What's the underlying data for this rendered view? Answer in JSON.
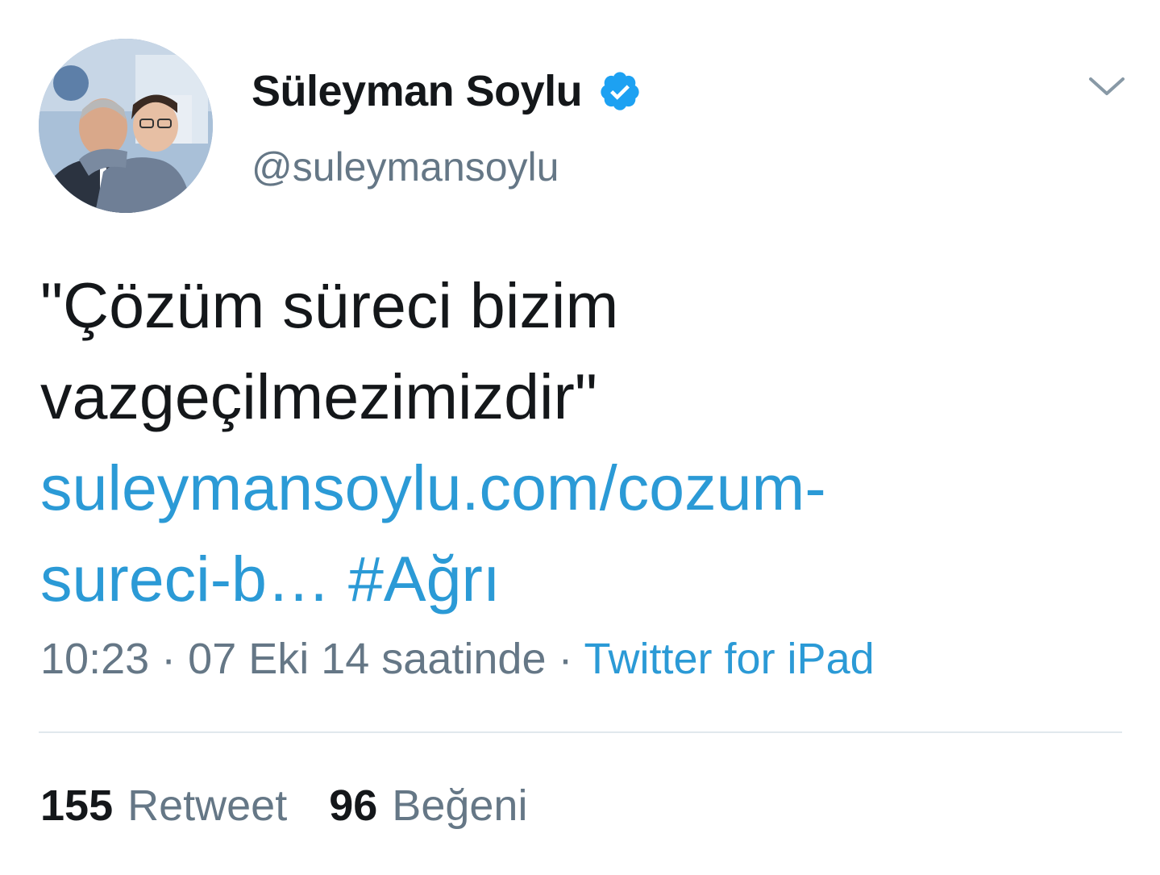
{
  "author": {
    "display_name": "Süleyman Soylu",
    "handle": "@suleymansoylu",
    "verified": true,
    "verified_color": "#1da1f2"
  },
  "tweet": {
    "text_line1": "\"Çözüm süreci bizim",
    "text_line2": "vazgeçilmezimizdir\"",
    "link_line1": "suleymansoylu.com/cozum-",
    "link_line2": "sureci-b…",
    "hashtag": "#Ağrı",
    "time": "10:23",
    "separator": "·",
    "date": "07 Eki 14 saatinde",
    "source": "Twitter for iPad"
  },
  "stats": {
    "retweet_count": "155",
    "retweet_label": "Retweet",
    "like_count": "96",
    "like_label": "Beğeni"
  },
  "icons": {
    "verified": "verified-badge-icon",
    "more": "chevron-down-icon"
  },
  "colors": {
    "link": "#2b9ad6",
    "text": "#14171a",
    "muted": "#657786",
    "divider": "#e1e8ed"
  }
}
